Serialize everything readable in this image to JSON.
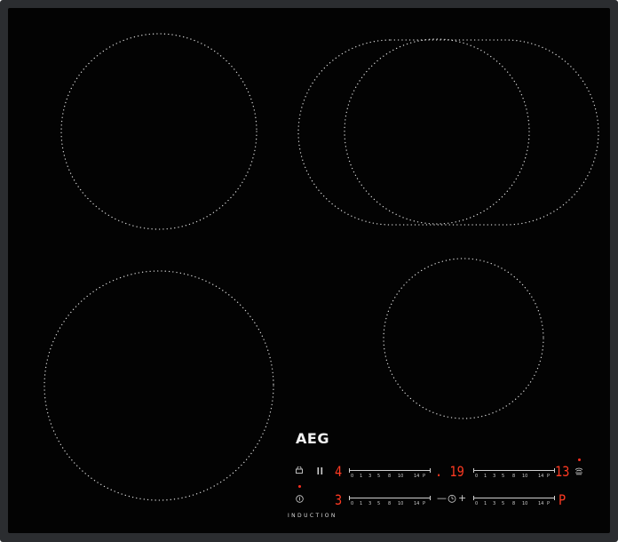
{
  "appliance": {
    "brand": "AEG",
    "type_label": "INDUCTION"
  },
  "cooking_zones": [
    {
      "name": "rear-left"
    },
    {
      "name": "rear-right-bridge"
    },
    {
      "name": "front-left"
    },
    {
      "name": "front-right"
    }
  ],
  "controls": {
    "icons": [
      "lock-icon",
      "pause-icon",
      "power-icon",
      "timer-icon",
      "minus-icon",
      "plus-icon",
      "hob2hood-icon"
    ],
    "minus_symbol": "—",
    "plus_symbol": "+",
    "zone_displays": {
      "top_left": "4",
      "top_middle": ". 19",
      "top_right": "13",
      "bottom_left": "3",
      "bottom_right": "P"
    },
    "slider_scale": [
      "0",
      "1",
      "3",
      "5",
      "8",
      "10",
      "14",
      "P"
    ],
    "colors": {
      "display": "#ff3a22",
      "glass": "#030303",
      "frame": "#2b2d30",
      "print": "#d0d0d0"
    }
  }
}
